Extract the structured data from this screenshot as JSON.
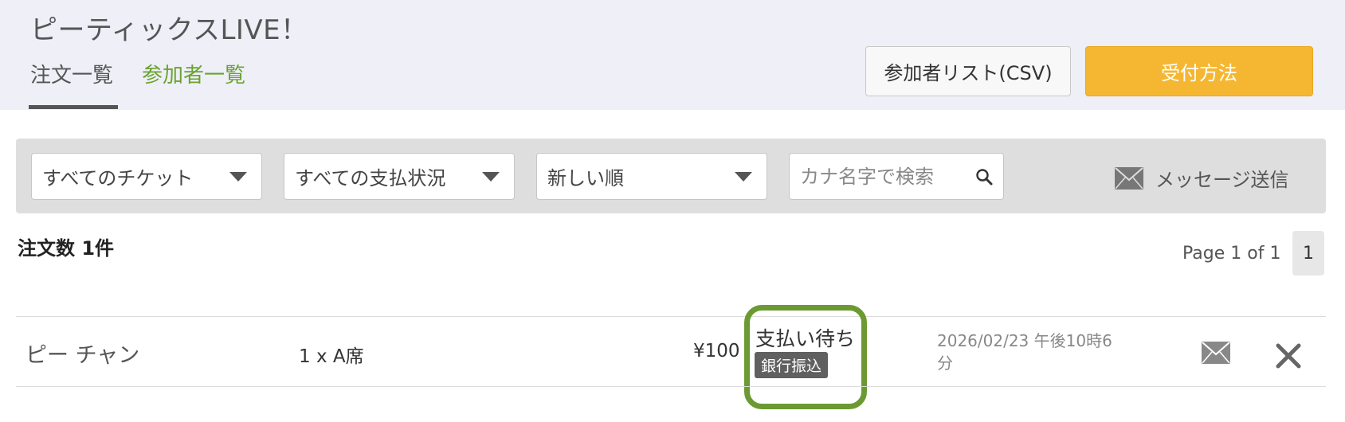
{
  "header": {
    "event_title": "ピーティックスLIVE！",
    "tabs": [
      {
        "label": "注文一覧",
        "active": true
      },
      {
        "label": "参加者一覧",
        "active": false
      }
    ],
    "csv_button_label": "参加者リスト(CSV)",
    "reception_button_label": "受付方法"
  },
  "filters": {
    "ticket_select": "すべてのチケット",
    "payment_select": "すべての支払状況",
    "sort_select": "新しい順",
    "search_placeholder": "カナ名字で検索",
    "message_send_label": "メッセージ送信"
  },
  "summary": {
    "order_count": "注文数 1件",
    "page_info": "Page 1 of 1",
    "current_page": "1"
  },
  "orders": [
    {
      "name": "ピー チャン",
      "ticket": "1 x A席",
      "price": "¥100",
      "status": "支払い待ち",
      "payment_method": "銀行振込",
      "date": "2026/02/23 午後10時6分"
    }
  ],
  "icons": {
    "search": "search-icon",
    "envelope": "envelope-icon",
    "cancel": "close-icon",
    "dropdown": "caret-down-icon"
  },
  "colors": {
    "accent_orange": "#f5b731",
    "tab_green": "#6aa32e",
    "highlight_green": "#6b9a32",
    "header_bg": "#eeeff7",
    "filter_bar_bg": "#dedede"
  }
}
